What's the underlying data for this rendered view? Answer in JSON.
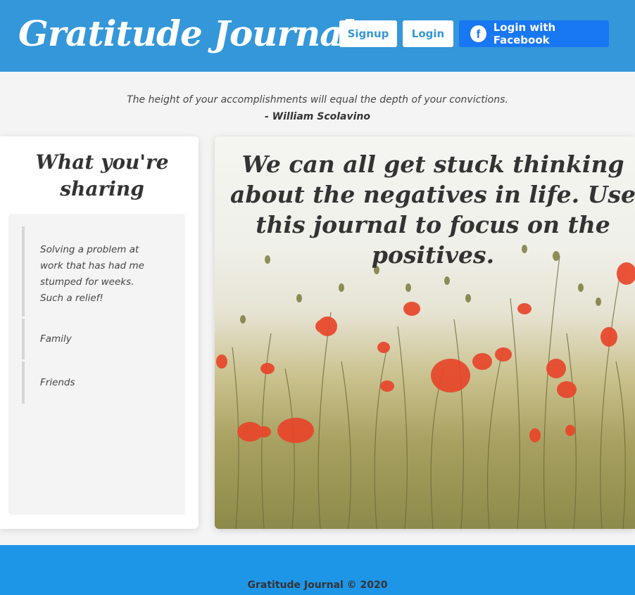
{
  "header": {
    "brand": "Gratitude Journal",
    "signup_label": "Signup",
    "login_label": "Login",
    "facebook_label": "Login with Facebook",
    "facebook_icon": "f",
    "bg_color": "#3497d9",
    "facebook_color": "#1877f2"
  },
  "quote": {
    "text": "The height of your accomplishments will equal the depth of your convictions.",
    "author": "- William Scolavino"
  },
  "sidebar": {
    "title": "What you're sharing",
    "entries": [
      "Solving a problem at work that has had me stumped for weeks. Such a relief!",
      "Family",
      "Friends"
    ]
  },
  "hero": {
    "text": "We can all get stuck thinking about the negatives in life. Use this journal to focus on the positives.",
    "image_icon": "poppy-field-image"
  },
  "footer": {
    "text": "Gratitude Journal © 2020",
    "bg_color": "#1e96e8"
  }
}
